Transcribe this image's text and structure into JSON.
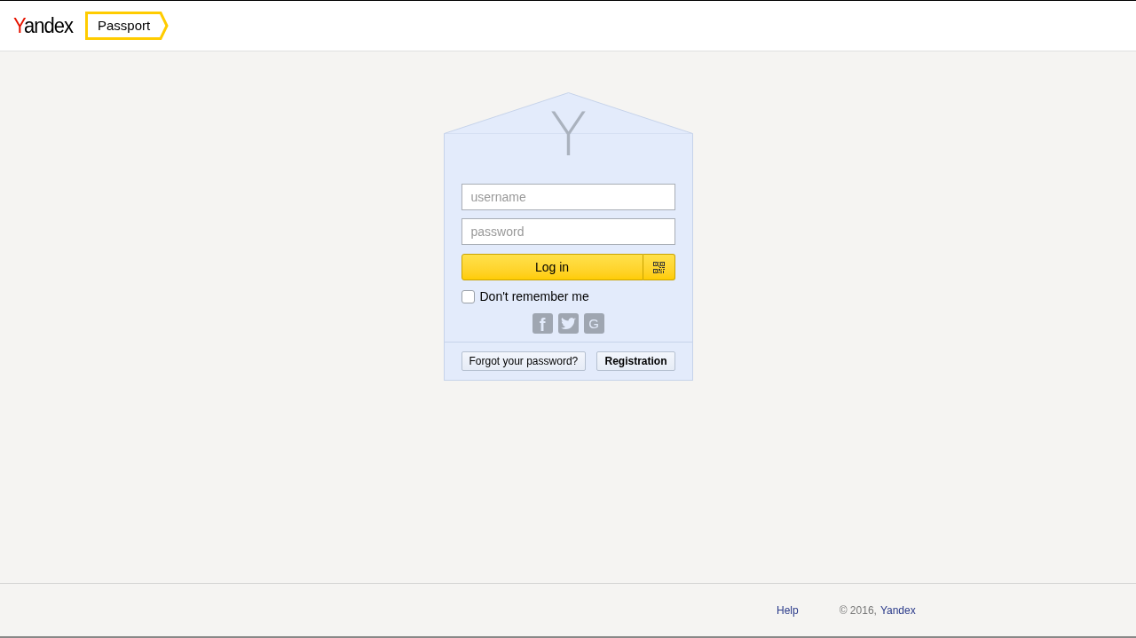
{
  "header": {
    "logo": "Yandex",
    "service_tab": "Passport"
  },
  "login_card": {
    "emblem": "Y",
    "username": {
      "placeholder": "username"
    },
    "password": {
      "placeholder": "password"
    },
    "login_button": "Log in",
    "remember": {
      "label": "Don't remember me",
      "checked": false
    },
    "social": [
      {
        "kind": "facebook",
        "glyph": "f"
      },
      {
        "kind": "twitter"
      },
      {
        "kind": "google",
        "glyph": "G"
      }
    ],
    "forgot_button": "Forgot your password?",
    "register_button": "Registration"
  },
  "footer": {
    "help_link": "Help",
    "copyright": "© 2016,",
    "company_link": "Yandex"
  }
}
